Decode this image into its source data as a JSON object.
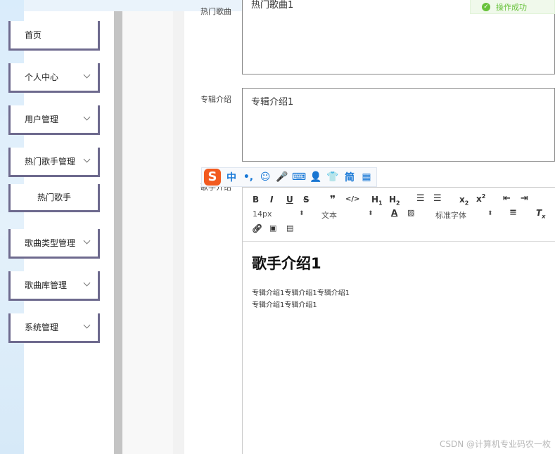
{
  "sidebar": {
    "items": [
      {
        "label": "首页",
        "chevron": false
      },
      {
        "label": "个人中心",
        "chevron": true
      },
      {
        "label": "用户管理",
        "chevron": true
      },
      {
        "label": "热门歌手管理",
        "chevron": true
      },
      {
        "label": "歌曲类型管理",
        "chevron": true
      },
      {
        "label": "歌曲库管理",
        "chevron": true
      },
      {
        "label": "系统管理",
        "chevron": true
      }
    ],
    "submenu": [
      {
        "label": "热门歌手"
      }
    ]
  },
  "form": {
    "hot_songs": {
      "label": "热门歌曲",
      "value": "热门歌曲1"
    },
    "album_intro": {
      "label": "专辑介绍",
      "value": "专辑介绍1"
    },
    "singer_intro": {
      "label": "歌手介绍"
    }
  },
  "editor": {
    "toolbar": {
      "font_size": "14px",
      "block_type": "文本",
      "font_family": "标准字体"
    },
    "content": {
      "heading": "歌手介绍1",
      "paragraphs": [
        "专辑介绍1专辑介绍1专辑介绍1",
        "专辑介绍1专辑介绍1"
      ]
    }
  },
  "ime": {
    "buttons": [
      "中",
      "•,",
      "☺",
      "🎤",
      "⌨",
      "👤",
      "👕",
      "简",
      "▦"
    ]
  },
  "toast": {
    "text": "操作成功"
  },
  "watermark": "CSDN @计算机专业码农一枚",
  "colors": {
    "sidebar_border": "#6e6a8e",
    "toast_green": "#67c23a",
    "ime_blue": "#1677d6",
    "ime_logo": "#f25a1f"
  }
}
